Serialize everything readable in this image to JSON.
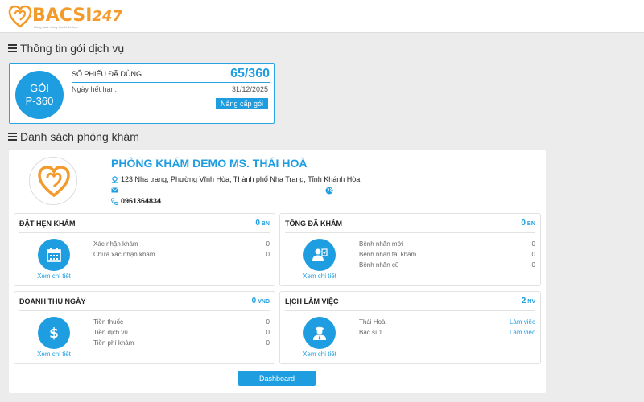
{
  "brand": {
    "name": "BACSI",
    "suffix": "247",
    "tagline": "Đồng hành cùng sức khỏe bạn"
  },
  "package_section": {
    "title": "Thông tin gói dịch vụ",
    "package_line1": "GÓI",
    "package_line2": "P-360",
    "used_label": "SỐ PHIẾU ĐÃ DÙNG",
    "used_value": "65/360",
    "expiry_label": "Ngày hết hạn:",
    "expiry_value": "31/12/2025",
    "upgrade_label": "Nâng cấp gói"
  },
  "clinic_section": {
    "title": "Danh sách phòng khám",
    "clinic_name": "PHÒNG KHÁM DEMO MS. THÁI HOÀ",
    "address": "123 Nha trang, Phường Vĩnh Hòa, Thành phố Nha Trang, Tỉnh Khánh Hòa",
    "email": "",
    "phone": "0961364834",
    "dashboard_label": "Dashboard"
  },
  "stats": {
    "appointments": {
      "title": "ĐẶT HẸN KHÁM",
      "count": "0",
      "unit": "BN",
      "link": "Xem chi tiết",
      "rows": [
        {
          "label": "Xác nhận khám",
          "value": "0"
        },
        {
          "label": "Chưa xác nhận khám",
          "value": "0"
        }
      ]
    },
    "examined": {
      "title": "TỔNG ĐÃ KHÁM",
      "count": "0",
      "unit": "BN",
      "link": "Xem chi tiết",
      "rows": [
        {
          "label": "Bệnh nhân mới",
          "value": "0"
        },
        {
          "label": "Bệnh nhân tái khám",
          "value": "0"
        },
        {
          "label": "Bệnh nhân cũ",
          "value": "0"
        }
      ]
    },
    "revenue": {
      "title": "DOANH THU NGÀY",
      "count": "0",
      "unit": "VNĐ",
      "link": "Xem chi tiết",
      "rows": [
        {
          "label": "Tiền thuốc",
          "value": "0"
        },
        {
          "label": "Tiền dịch vụ",
          "value": "0"
        },
        {
          "label": "Tiền phí khám",
          "value": "0"
        }
      ]
    },
    "schedule": {
      "title": "LỊCH LÀM VIỆC",
      "count": "2",
      "unit": "NV",
      "link": "Xem chi tiết",
      "rows": [
        {
          "label": "Thái Hoà",
          "value": "Làm việc"
        },
        {
          "label": "Bác sĩ 1",
          "value": "Làm việc"
        }
      ]
    }
  },
  "colors": {
    "accent": "#1e9ee0",
    "brand": "#f39a2b",
    "background": "#ececec"
  },
  "icons": {
    "section": "list-icon",
    "address": "location-pin-icon",
    "email": "envelope-icon",
    "phone": "phone-icon",
    "website": "globe-icon",
    "appointments": "calendar-icon",
    "examined": "patient-icon",
    "revenue": "dollar-icon",
    "schedule": "doctor-icon"
  }
}
